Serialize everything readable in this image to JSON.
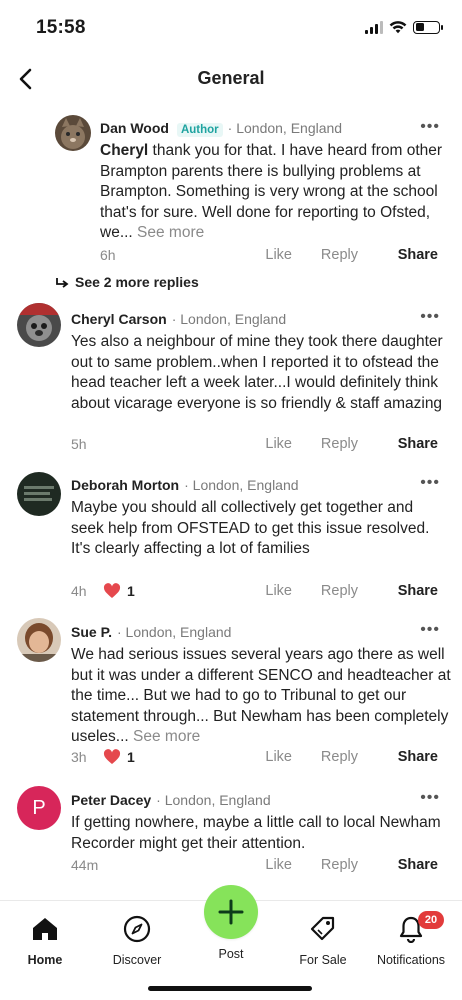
{
  "status_bar": {
    "time": "15:58"
  },
  "header": {
    "title": "General"
  },
  "comments": [
    {
      "name": "Dan Wood",
      "badge": "Author",
      "location": "· London, England",
      "mention": "Cheryl",
      "text": " thank you for that. I have heard from other Brampton parents there is bullying problems at Brampton. Something is very wrong at the school that's for sure. Well done for reporting to Ofsted, we...",
      "see_more": "See more",
      "time": "6h"
    },
    {
      "name": "Cheryl Carson",
      "location": "· London, England",
      "text": "Yes also a neighbour of mine they took there daughter out to same problem..when I reported it to ofstead the head teacher left a week later...I would definitely think about vicarage everyone is so friendly & staff amazing",
      "time": "5h"
    },
    {
      "name": "Deborah Morton",
      "location": "· London, England",
      "text": "Maybe you should all collectively get together and seek help from OFSTEAD to get this issue resolved.  It's clearly affecting a lot of families",
      "time": "4h",
      "reactions": "1"
    },
    {
      "name": "Sue P.",
      "location": "· London, England",
      "text": "We had serious issues several years ago there as well but it was under a different SENCO and headteacher at the time... But we had to go to Tribunal to get our statement through... But Newham has been completely useles...",
      "see_more": "See more",
      "time": "3h",
      "reactions": "1"
    },
    {
      "name": "Peter Dacey",
      "avatar_initial": "P",
      "location": "· London, England",
      "text": "If getting nowhere, maybe a little call to local Newham Recorder might get their attention.",
      "time": "44m"
    }
  ],
  "actions": {
    "like": "Like",
    "reply": "Reply",
    "share": "Share",
    "more": "•••"
  },
  "see_replies": "See 2 more replies",
  "tabs": {
    "home": "Home",
    "discover": "Discover",
    "post": "Post",
    "for_sale": "For Sale",
    "notifications": "Notifications",
    "notifications_count": "20"
  },
  "colors": {
    "accent_green": "#86e35a",
    "author_teal": "#1fa3a0",
    "badge_red": "#e23b3b",
    "heart_red": "#e5484d",
    "peter_avatar": "#d7265a"
  }
}
